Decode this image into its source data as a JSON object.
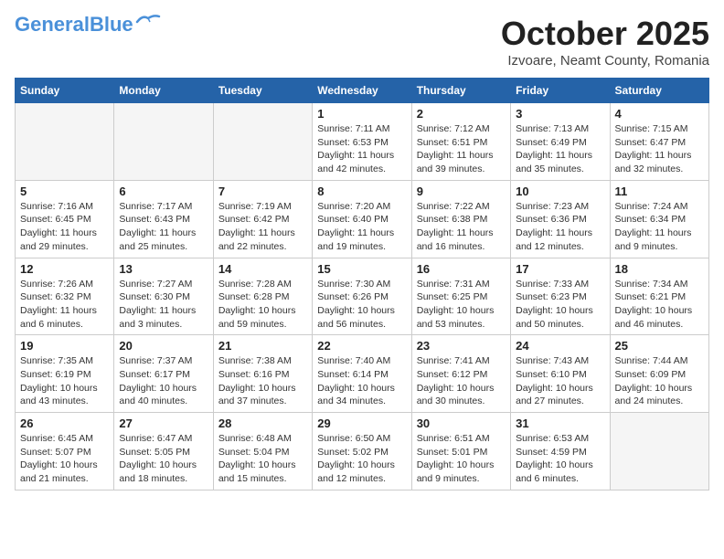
{
  "header": {
    "logo_general": "General",
    "logo_blue": "Blue",
    "month": "October 2025",
    "location": "Izvoare, Neamt County, Romania"
  },
  "weekdays": [
    "Sunday",
    "Monday",
    "Tuesday",
    "Wednesday",
    "Thursday",
    "Friday",
    "Saturday"
  ],
  "weeks": [
    [
      {
        "day": "",
        "info": ""
      },
      {
        "day": "",
        "info": ""
      },
      {
        "day": "",
        "info": ""
      },
      {
        "day": "1",
        "info": "Sunrise: 7:11 AM\nSunset: 6:53 PM\nDaylight: 11 hours and 42 minutes."
      },
      {
        "day": "2",
        "info": "Sunrise: 7:12 AM\nSunset: 6:51 PM\nDaylight: 11 hours and 39 minutes."
      },
      {
        "day": "3",
        "info": "Sunrise: 7:13 AM\nSunset: 6:49 PM\nDaylight: 11 hours and 35 minutes."
      },
      {
        "day": "4",
        "info": "Sunrise: 7:15 AM\nSunset: 6:47 PM\nDaylight: 11 hours and 32 minutes."
      }
    ],
    [
      {
        "day": "5",
        "info": "Sunrise: 7:16 AM\nSunset: 6:45 PM\nDaylight: 11 hours and 29 minutes."
      },
      {
        "day": "6",
        "info": "Sunrise: 7:17 AM\nSunset: 6:43 PM\nDaylight: 11 hours and 25 minutes."
      },
      {
        "day": "7",
        "info": "Sunrise: 7:19 AM\nSunset: 6:42 PM\nDaylight: 11 hours and 22 minutes."
      },
      {
        "day": "8",
        "info": "Sunrise: 7:20 AM\nSunset: 6:40 PM\nDaylight: 11 hours and 19 minutes."
      },
      {
        "day": "9",
        "info": "Sunrise: 7:22 AM\nSunset: 6:38 PM\nDaylight: 11 hours and 16 minutes."
      },
      {
        "day": "10",
        "info": "Sunrise: 7:23 AM\nSunset: 6:36 PM\nDaylight: 11 hours and 12 minutes."
      },
      {
        "day": "11",
        "info": "Sunrise: 7:24 AM\nSunset: 6:34 PM\nDaylight: 11 hours and 9 minutes."
      }
    ],
    [
      {
        "day": "12",
        "info": "Sunrise: 7:26 AM\nSunset: 6:32 PM\nDaylight: 11 hours and 6 minutes."
      },
      {
        "day": "13",
        "info": "Sunrise: 7:27 AM\nSunset: 6:30 PM\nDaylight: 11 hours and 3 minutes."
      },
      {
        "day": "14",
        "info": "Sunrise: 7:28 AM\nSunset: 6:28 PM\nDaylight: 10 hours and 59 minutes."
      },
      {
        "day": "15",
        "info": "Sunrise: 7:30 AM\nSunset: 6:26 PM\nDaylight: 10 hours and 56 minutes."
      },
      {
        "day": "16",
        "info": "Sunrise: 7:31 AM\nSunset: 6:25 PM\nDaylight: 10 hours and 53 minutes."
      },
      {
        "day": "17",
        "info": "Sunrise: 7:33 AM\nSunset: 6:23 PM\nDaylight: 10 hours and 50 minutes."
      },
      {
        "day": "18",
        "info": "Sunrise: 7:34 AM\nSunset: 6:21 PM\nDaylight: 10 hours and 46 minutes."
      }
    ],
    [
      {
        "day": "19",
        "info": "Sunrise: 7:35 AM\nSunset: 6:19 PM\nDaylight: 10 hours and 43 minutes."
      },
      {
        "day": "20",
        "info": "Sunrise: 7:37 AM\nSunset: 6:17 PM\nDaylight: 10 hours and 40 minutes."
      },
      {
        "day": "21",
        "info": "Sunrise: 7:38 AM\nSunset: 6:16 PM\nDaylight: 10 hours and 37 minutes."
      },
      {
        "day": "22",
        "info": "Sunrise: 7:40 AM\nSunset: 6:14 PM\nDaylight: 10 hours and 34 minutes."
      },
      {
        "day": "23",
        "info": "Sunrise: 7:41 AM\nSunset: 6:12 PM\nDaylight: 10 hours and 30 minutes."
      },
      {
        "day": "24",
        "info": "Sunrise: 7:43 AM\nSunset: 6:10 PM\nDaylight: 10 hours and 27 minutes."
      },
      {
        "day": "25",
        "info": "Sunrise: 7:44 AM\nSunset: 6:09 PM\nDaylight: 10 hours and 24 minutes."
      }
    ],
    [
      {
        "day": "26",
        "info": "Sunrise: 6:45 AM\nSunset: 5:07 PM\nDaylight: 10 hours and 21 minutes."
      },
      {
        "day": "27",
        "info": "Sunrise: 6:47 AM\nSunset: 5:05 PM\nDaylight: 10 hours and 18 minutes."
      },
      {
        "day": "28",
        "info": "Sunrise: 6:48 AM\nSunset: 5:04 PM\nDaylight: 10 hours and 15 minutes."
      },
      {
        "day": "29",
        "info": "Sunrise: 6:50 AM\nSunset: 5:02 PM\nDaylight: 10 hours and 12 minutes."
      },
      {
        "day": "30",
        "info": "Sunrise: 6:51 AM\nSunset: 5:01 PM\nDaylight: 10 hours and 9 minutes."
      },
      {
        "day": "31",
        "info": "Sunrise: 6:53 AM\nSunset: 4:59 PM\nDaylight: 10 hours and 6 minutes."
      },
      {
        "day": "",
        "info": ""
      }
    ]
  ]
}
